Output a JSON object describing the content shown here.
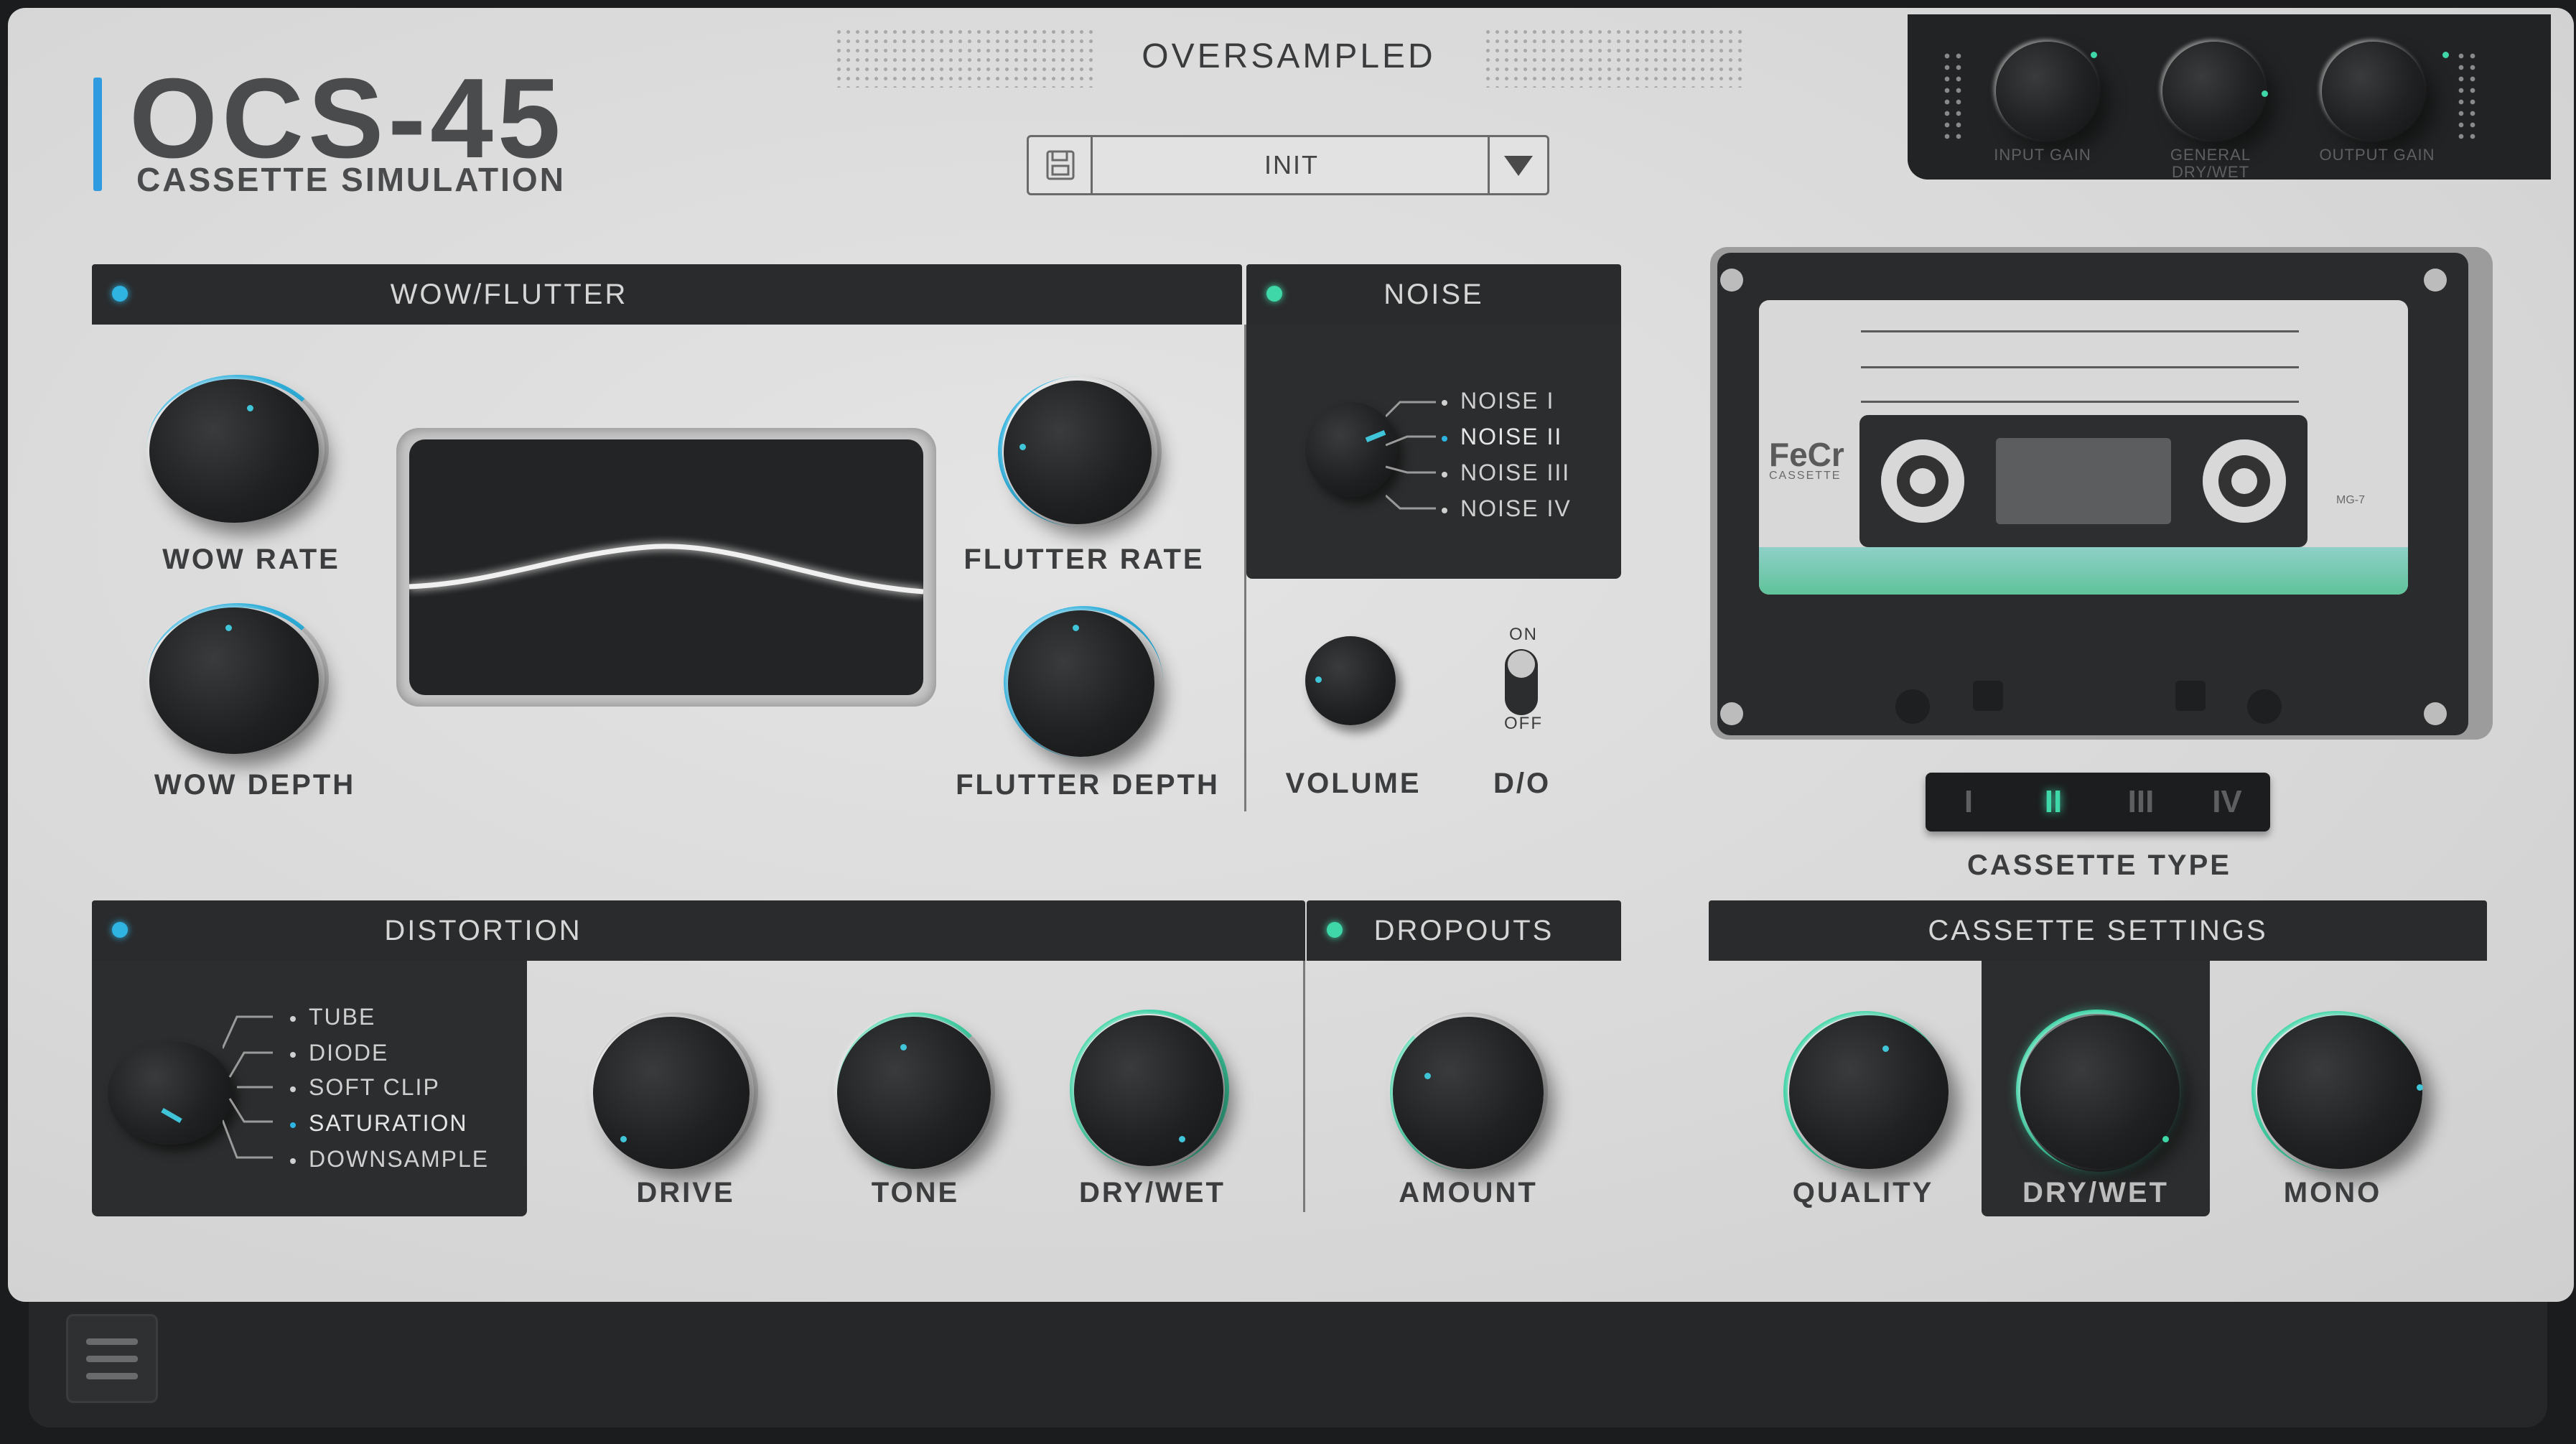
{
  "brand": {
    "name": "OCS-45",
    "subtitle": "CASSETTE SIMULATION"
  },
  "header": {
    "mode": "OVERSAMPLED",
    "preset": "INIT"
  },
  "io": {
    "input_gain": "INPUT GAIN",
    "general_drywet": "GENERAL DRY/WET",
    "output_gain": "OUTPUT GAIN"
  },
  "wow_flutter": {
    "title": "WOW/FLUTTER",
    "wow_rate": "WOW RATE",
    "wow_depth": "WOW DEPTH",
    "flutter_rate": "FLUTTER RATE",
    "flutter_depth": "FLUTTER DEPTH"
  },
  "noise": {
    "title": "NOISE",
    "options": [
      "NOISE I",
      "NOISE II",
      "NOISE III",
      "NOISE IV"
    ],
    "volume": "VOLUME",
    "do": "D/O",
    "toggle_on": "ON",
    "toggle_off": "OFF"
  },
  "cassette": {
    "brand": "FeCr",
    "brand_sub": "CASSETTE",
    "model": "MG-7",
    "type_label": "CASSETTE TYPE",
    "types": [
      "I",
      "II",
      "III",
      "IV"
    ],
    "active_type": "II"
  },
  "distortion": {
    "title": "DISTORTION",
    "options": [
      "TUBE",
      "DIODE",
      "SOFT CLIP",
      "SATURATION",
      "DOWNSAMPLE"
    ],
    "active_option": "SATURATION",
    "drive": "DRIVE",
    "tone": "TONE",
    "drywet": "DRY/WET"
  },
  "dropouts": {
    "title": "DROPOUTS",
    "amount": "AMOUNT"
  },
  "cassette_settings": {
    "title": "CASSETTE SETTINGS",
    "quality": "QUALITY",
    "drywet": "DRY/WET",
    "mono": "MONO"
  },
  "colors": {
    "accent_blue": "#2fb3e0",
    "accent_green": "#3fd6a8",
    "panel": "#dcdcdc",
    "dark": "#2a2b2c"
  }
}
